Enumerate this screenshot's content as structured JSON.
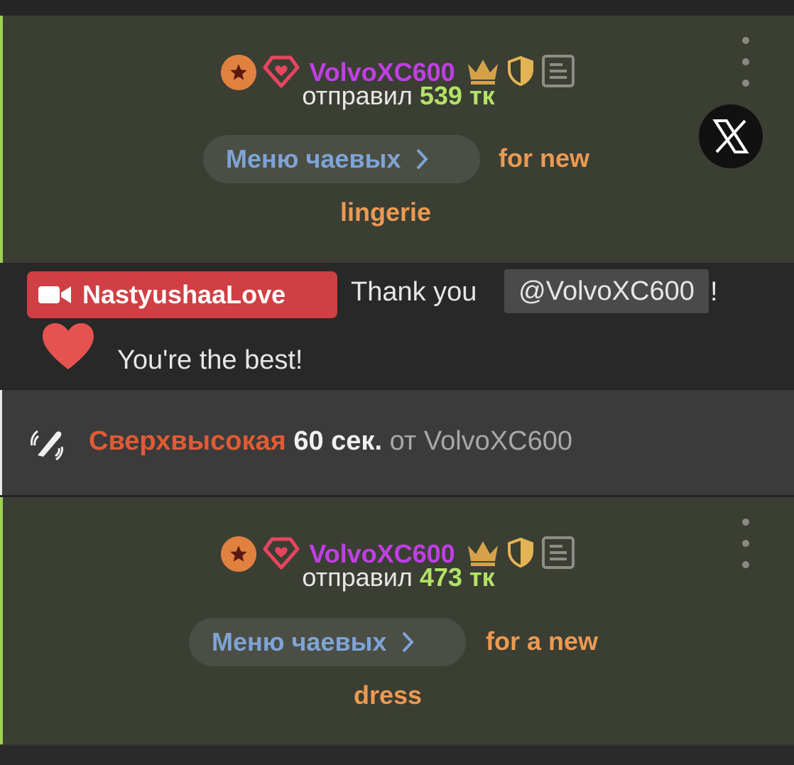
{
  "tips": [
    {
      "username": "VolvoXC600",
      "sent_prefix": "отправил",
      "amount": "539 тк",
      "menu_label": "Меню чаевых",
      "note_line1": "for new",
      "note_line2": "lingerie"
    },
    {
      "username": "VolvoXC600",
      "sent_prefix": "отправил",
      "amount": "473 тк",
      "menu_label": "Меню чаевых",
      "note_line1": "for a new",
      "note_line2": "dress"
    }
  ],
  "chat": {
    "broadcaster": "NastyushaaLove",
    "text": "Thank you",
    "mention": "@VolvoXC600",
    "punct": "!",
    "line2": "You're the best!"
  },
  "toy": {
    "level": "Сверхвысокая",
    "duration": "60 сек.",
    "from_prefix": "от",
    "from_user": "VolvoXC600"
  },
  "colors": {
    "tip_bg": "#3b3e33",
    "tip_accent": "#9fd157",
    "username": "#c13ee6",
    "amount": "#b2e267",
    "menu_text": "#7ea4d6",
    "note": "#ec9a52",
    "broadcaster_badge": "#cf3f43",
    "toy_level": "#e05b34"
  },
  "icons": [
    "star-badge-icon",
    "diamond-heart-icon",
    "crown-icon",
    "shield-icon",
    "notes-icon",
    "kebab-menu-icon",
    "x-logo-icon",
    "video-camera-icon",
    "heart-icon",
    "vibrator-icon",
    "chevron-right-icon"
  ]
}
